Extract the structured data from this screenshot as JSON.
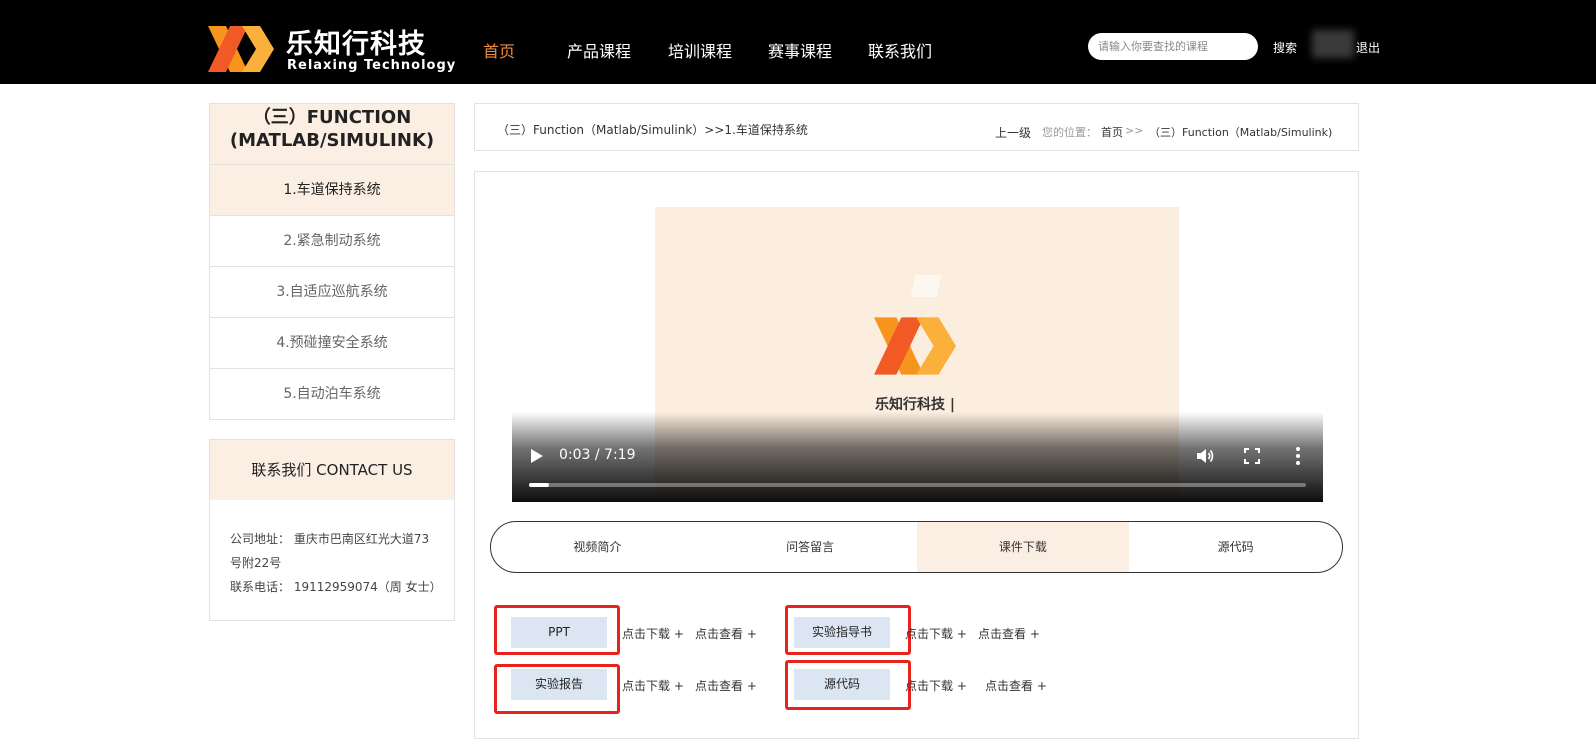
{
  "header": {
    "brand_cn": "乐知行科技",
    "brand_en": "Relaxing Technology",
    "nav": [
      "首页",
      "产品课程",
      "培训课程",
      "赛事课程",
      "联系我们"
    ],
    "search_placeholder": "请输入你要查找的课程",
    "search_button": "搜索",
    "logout": "退出"
  },
  "sidebar": {
    "title_line1": "（三）FUNCTION",
    "title_line2": "(MATLAB/SIMULINK)",
    "items": [
      "1.车道保持系统",
      "2.紧急制动系统",
      "3.自适应巡航系统",
      "4.预碰撞安全系统",
      "5.自动泊车系统"
    ],
    "active_index": 0
  },
  "contact": {
    "title": "联系我们 CONTACT US",
    "address_line1": "公司地址： 重庆市巴南区红光大道73",
    "address_line2": "号附22号",
    "phone": "联系电话： 19112959074（周 女士）"
  },
  "breadcrumb": {
    "current_path": "（三）Function（Matlab/Simulink）>>1.车道保持系统",
    "up_level": "上一级",
    "position_label": "您的位置：",
    "home": "首页",
    "separator": ">>",
    "current": "（三）Function（Matlab/Simulink)"
  },
  "video": {
    "poster_text": "乐知行科技 |",
    "time": "0:03 / 7:19",
    "progress_fraction": 0.026
  },
  "tabs": [
    "视频简介",
    "问答留言",
    "课件下载",
    "源代码"
  ],
  "active_tab": 2,
  "downloads": {
    "items": [
      "PPT",
      "实验指导书",
      "实验报告",
      "源代码"
    ],
    "download_label": "点击下载 +",
    "view_label": "点击查看 +"
  },
  "colors": {
    "accent_orange": "#f08a3e",
    "highlight_bg": "#fbefe4",
    "annotation_red": "#e8231c",
    "button_blue": "#dce5f2"
  }
}
